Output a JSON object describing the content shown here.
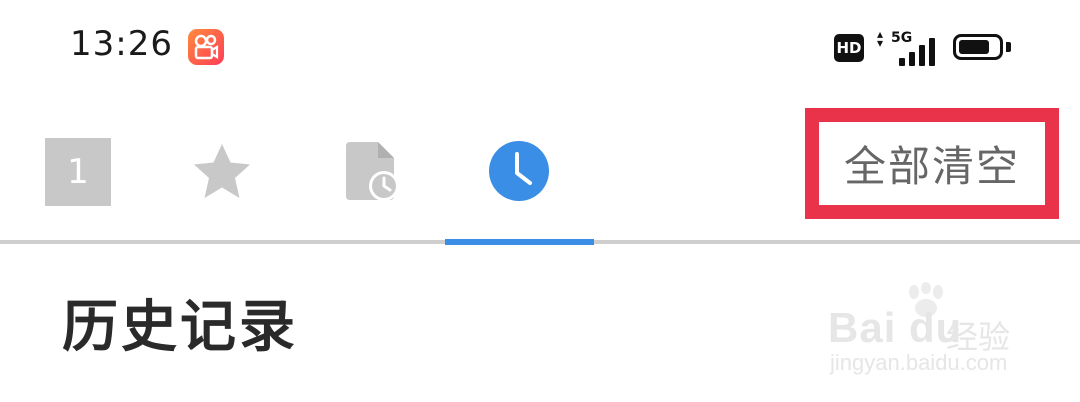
{
  "status_bar": {
    "time": "13:26",
    "hd_label": "HD",
    "network_label": "5G",
    "battery_level": 0.8
  },
  "tabs": [
    {
      "id": "count",
      "label": "1",
      "icon": "square-count-icon"
    },
    {
      "id": "favorites",
      "icon": "star-icon"
    },
    {
      "id": "recent-files",
      "icon": "document-clock-icon"
    },
    {
      "id": "history",
      "icon": "clock-icon",
      "active": true
    }
  ],
  "toolbar": {
    "clear_all_label": "全部清空"
  },
  "section": {
    "title": "历史记录"
  },
  "watermark": {
    "brand": "Bai du",
    "brand_cn": "经验",
    "url": "jingyan.baidu.com"
  },
  "colors": {
    "accent": "#3a8ee6",
    "highlight_border": "#e8334a",
    "inactive_icon": "#c8c8c8"
  }
}
